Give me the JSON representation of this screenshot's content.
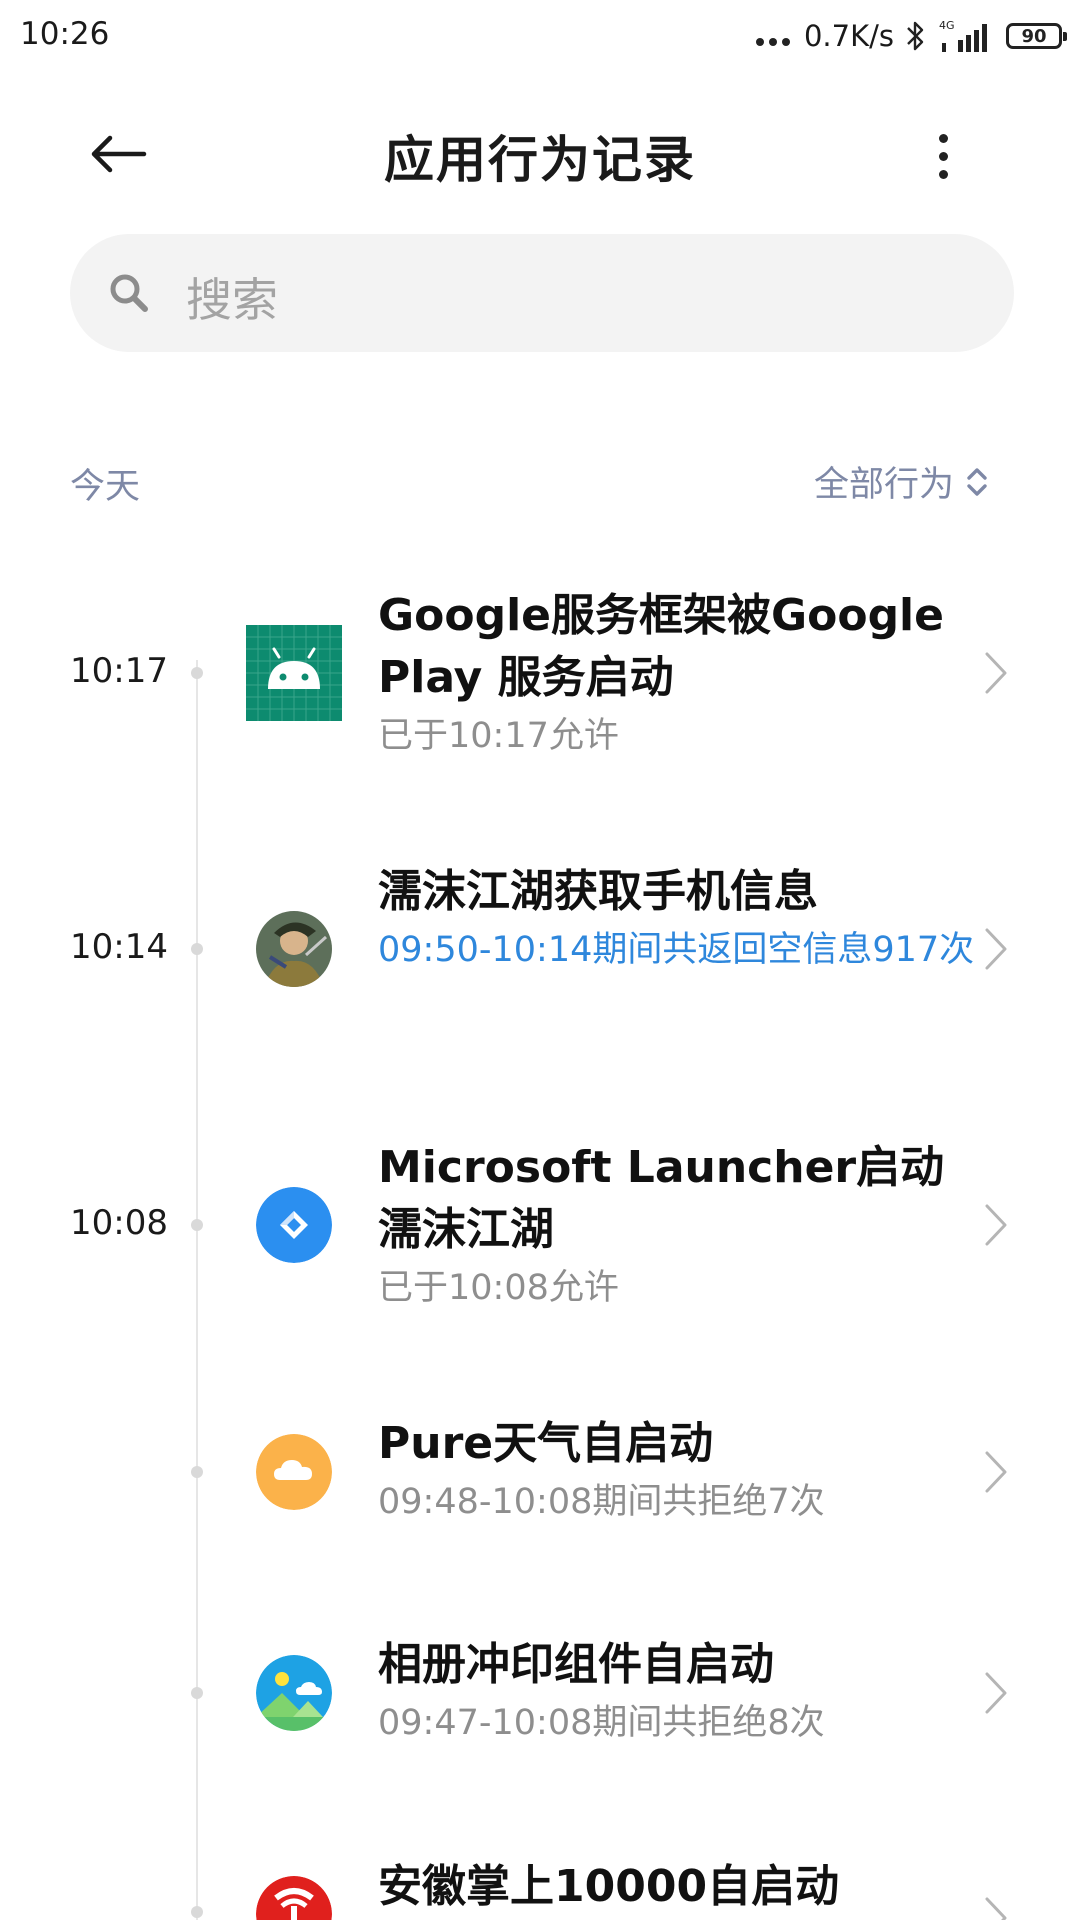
{
  "status_bar": {
    "time": "10:26",
    "net_speed": "0.7K/s",
    "network_type": "4G",
    "battery": "90"
  },
  "header": {
    "title": "应用行为记录"
  },
  "search": {
    "placeholder": "搜索"
  },
  "section": {
    "day": "今天",
    "filter_label": "全部行为"
  },
  "colors": {
    "accent_blue": "#2e87dc",
    "section_label": "#7e88a6",
    "subtitle_gray": "#8e8e8e"
  },
  "entries": [
    {
      "time": "10:17",
      "title": "Google服务框架被Google Play 服务启动",
      "subtitle": "已于10:17允许",
      "icon": "android-icon"
    },
    {
      "time": "10:14",
      "title": "濡沫江湖获取手机信息",
      "subtitle": "09:50-10:14期间共返回空信息917次",
      "icon": "game-avatar-icon"
    },
    {
      "time": "10:08",
      "title": "Microsoft Launcher启动濡沫江湖",
      "subtitle": "已于10:08允许",
      "icon": "microsoft-launcher-icon"
    },
    {
      "time": "",
      "title": "Pure天气自启动",
      "subtitle": "09:48-10:08期间共拒绝7次",
      "icon": "weather-cloud-icon"
    },
    {
      "time": "",
      "title": "相册冲印组件自启动",
      "subtitle": "09:47-10:08期间共拒绝8次",
      "icon": "photo-print-icon"
    },
    {
      "time": "",
      "title": "安徽掌上10000自启动",
      "subtitle": "",
      "icon": "telecom-icon"
    }
  ]
}
